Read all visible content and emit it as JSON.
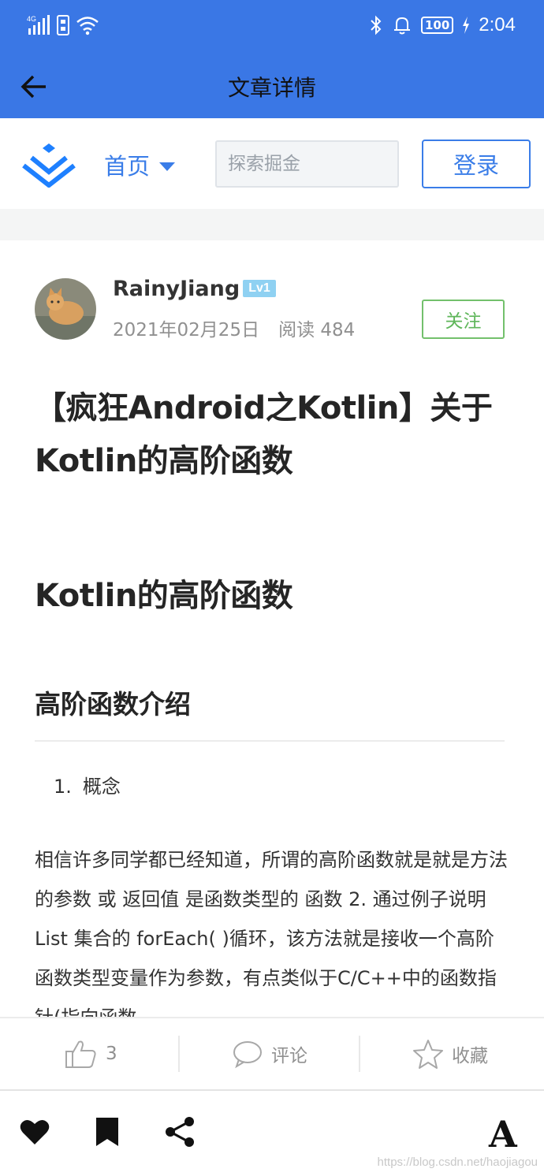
{
  "status_bar": {
    "network": "4G",
    "battery": "100",
    "time": "2:04"
  },
  "app_bar": {
    "title": "文章详情",
    "back_icon": "arrow-left-icon"
  },
  "site_header": {
    "logo_icon": "juejin-logo-icon",
    "home_label": "首页",
    "search_placeholder": "探索掘金",
    "login_label": "登录",
    "accent_color": "#3a7de8"
  },
  "author": {
    "name": "RainyJiang",
    "level": "Lv1",
    "date": "2021年02月25日",
    "reads": "阅读 484",
    "follow_label": "关注",
    "follow_color": "#5fb65a"
  },
  "article": {
    "title": "【疯狂Android之Kotlin】关于Kotlin的高阶函数",
    "heading1": "Kotlin的高阶函数",
    "heading2": "高阶函数介绍",
    "list_items": [
      {
        "num": "1.",
        "text": "概念"
      }
    ],
    "paragraph": "相信许多同学都已经知道，所谓的高阶函数就是就是方法的参数 或 返回值 是函数类型的 函数 2. 通过例子说明 List 集合的 forEach( )循环，该方法就是接收一个高阶函数类型变量作为参数，有点类似于C/C++中的函数指针(指向函数"
  },
  "actions": {
    "like_icon": "thumbs-up-icon",
    "like_count": "3",
    "comment_icon": "comment-icon",
    "comment_label": "评论",
    "collect_icon": "star-icon",
    "collect_label": "收藏"
  },
  "bottom_bar": {
    "heart_icon": "heart-icon",
    "bookmark_icon": "bookmark-icon",
    "share_icon": "share-icon",
    "font_label": "A",
    "watermark": "https://blog.csdn.net/haojiagou"
  }
}
